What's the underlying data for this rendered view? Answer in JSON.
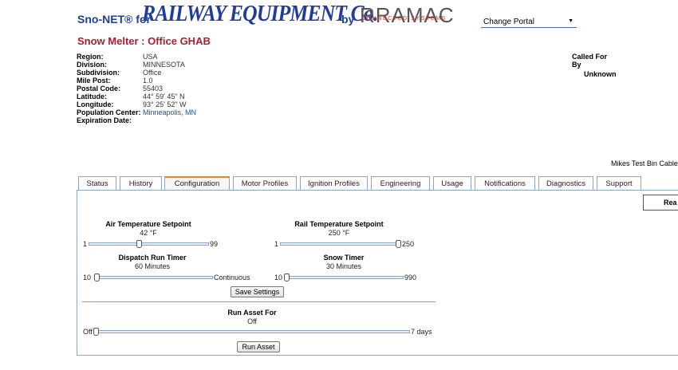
{
  "header": {
    "brand_prefix": "Sno-NET® for",
    "brand_main": "RAILWAY EQUIPMENT Co.",
    "brand_by": "by",
    "logo_text": "RRAMAC",
    "logo_sub": "CONNECTED SYSTEMS",
    "portal_selected": "Change Portal"
  },
  "page_title": "Snow Melter : Office GHAB",
  "info": [
    {
      "label": "Region:",
      "value": "USA"
    },
    {
      "label": "Division:",
      "value": "MINNESOTA"
    },
    {
      "label": "Subdivision:",
      "value": "Office"
    },
    {
      "label": "Mile Post:",
      "value": "1.0"
    },
    {
      "label": "Postal Code:",
      "value": "55403"
    },
    {
      "label": "Latitude:",
      "value": "44° 59' 45\" N"
    },
    {
      "label": "Longitude:",
      "value": "93° 25' 52\" W"
    },
    {
      "label": "Population Center:",
      "value": "Minneapolis, MN"
    },
    {
      "label": "Expiration Date:",
      "value": ""
    }
  ],
  "called_for": {
    "label_line1": "Called For",
    "label_line2": "By",
    "value": "Unknown"
  },
  "cable_text": "Mikes Test Bin Cable",
  "tabs": [
    "Status",
    "History",
    "Configuration",
    "Motor Profiles",
    "Ignition Profiles",
    "Engineering",
    "Usage",
    "Notifications",
    "Diagnostics",
    "Support"
  ],
  "active_tab": "Configuration",
  "read_button": "Rea",
  "controls": {
    "air_temp": {
      "title": "Air Temperature Setpoint",
      "value": "42 °F",
      "min": "1",
      "max": "99",
      "level": 0.42
    },
    "rail_temp": {
      "title": "Rail Temperature Setpoint",
      "value": "250 °F",
      "min": "1",
      "max": "250",
      "level": 1.0
    },
    "dispatch": {
      "title": "Dispatch Run Timer",
      "value": "60 Minutes",
      "min": "10",
      "max": "Continuous",
      "level": 0.0
    },
    "snow_timer": {
      "title": "Snow Timer",
      "value": "30 Minutes",
      "min": "10",
      "max": "990",
      "level": 0.0
    },
    "save_label": "Save Settings",
    "run_asset": {
      "title": "Run Asset For",
      "value": "Off",
      "min": "Off",
      "max": "7 days",
      "level": 0.0
    },
    "run_label": "Run Asset"
  }
}
